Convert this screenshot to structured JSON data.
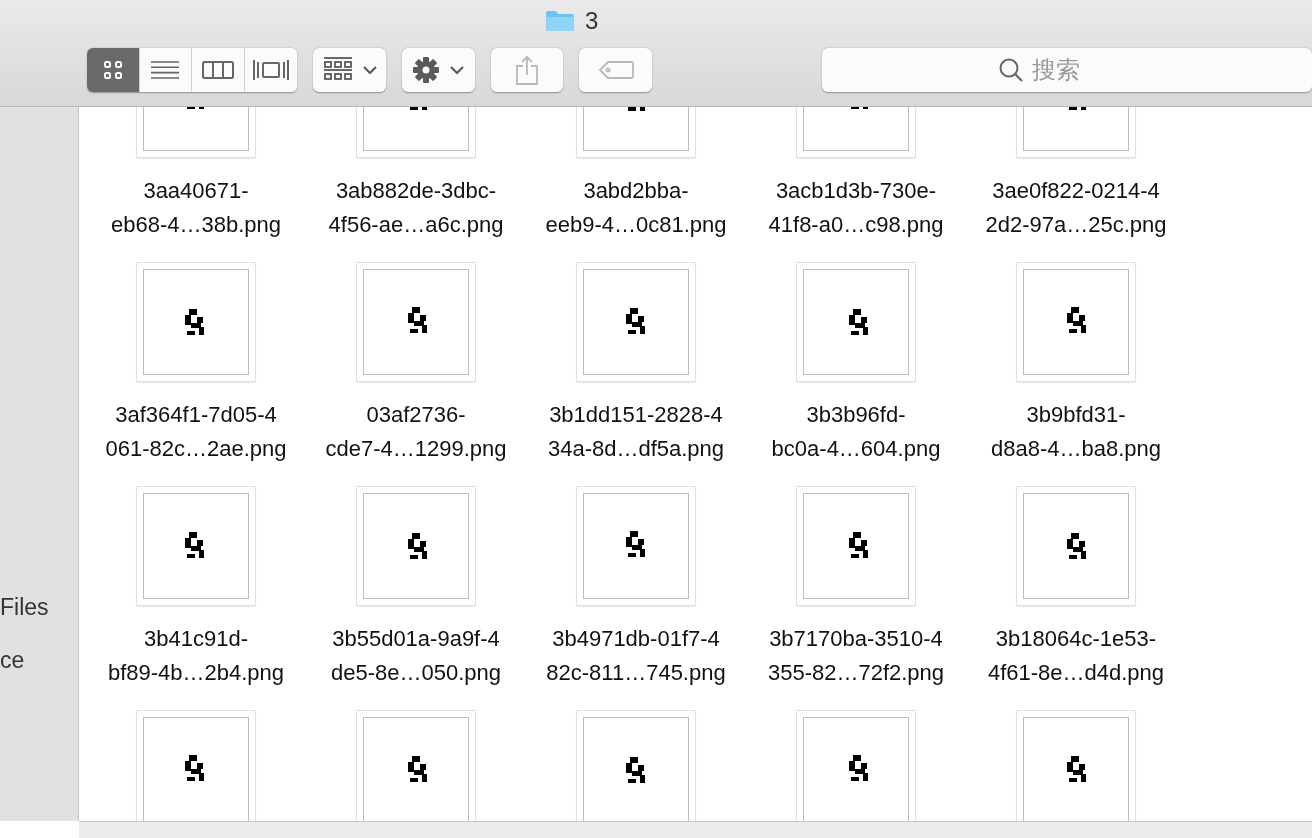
{
  "window": {
    "title": "3"
  },
  "toolbar": {
    "view_modes": [
      {
        "kind": "icons",
        "selected": true
      },
      {
        "kind": "list",
        "selected": false
      },
      {
        "kind": "columns",
        "selected": false
      },
      {
        "kind": "gallery",
        "selected": false
      }
    ],
    "buttons": [
      {
        "kind": "arrange",
        "disabled": false
      },
      {
        "kind": "action",
        "disabled": false
      },
      {
        "kind": "share",
        "disabled": true
      },
      {
        "kind": "tag",
        "disabled": true
      }
    ],
    "search": {
      "placeholder": "搜索"
    }
  },
  "sidebar": {
    "items": [
      {
        "label": "Files"
      },
      {
        "label": "ce"
      }
    ]
  },
  "files": [
    {
      "kind": "picture",
      "name_lines": [
        "3aa40671-",
        "eb68-4…38b.png"
      ]
    },
    {
      "kind": "picture",
      "name_lines": [
        "3ab882de-3dbc-",
        "4f56-ae…a6c.png"
      ]
    },
    {
      "kind": "picture",
      "name_lines": [
        "3abd2bba-",
        "eeb9-4…0c81.png"
      ]
    },
    {
      "kind": "picture",
      "name_lines": [
        "3acb1d3b-730e-",
        "41f8-a0…c98.png"
      ]
    },
    {
      "kind": "picture",
      "name_lines": [
        "3ae0f822-0214-4",
        "2d2-97a…25c.png"
      ]
    },
    {
      "kind": "picture",
      "name_lines": [
        "3af364f1-7d05-4",
        "061-82c…2ae.png"
      ]
    },
    {
      "kind": "picture",
      "name_lines": [
        "03af2736-",
        "cde7-4…1299.png"
      ]
    },
    {
      "kind": "picture",
      "name_lines": [
        "3b1dd151-2828-4",
        "34a-8d…df5a.png"
      ]
    },
    {
      "kind": "picture",
      "name_lines": [
        "3b3b96fd-",
        "bc0a-4…604.png"
      ]
    },
    {
      "kind": "picture",
      "name_lines": [
        "3b9bfd31-",
        "d8a8-4…ba8.png"
      ]
    },
    {
      "kind": "picture",
      "name_lines": [
        "3b41c91d-",
        "bf89-4b…2b4.png"
      ]
    },
    {
      "kind": "picture",
      "name_lines": [
        "3b55d01a-9a9f-4",
        "de5-8e…050.png"
      ]
    },
    {
      "kind": "picture",
      "name_lines": [
        "3b4971db-01f7-4",
        "82c-811…745.png"
      ]
    },
    {
      "kind": "picture",
      "name_lines": [
        "3b7170ba-3510-4",
        "355-82…72f2.png"
      ]
    },
    {
      "kind": "picture",
      "name_lines": [
        "3b18064c-1e53-",
        "4f61-8e…d4d.png"
      ]
    },
    {
      "kind": "picture"
    },
    {
      "kind": "picture"
    },
    {
      "kind": "picture"
    },
    {
      "kind": "picture"
    },
    {
      "kind": "picture"
    }
  ]
}
